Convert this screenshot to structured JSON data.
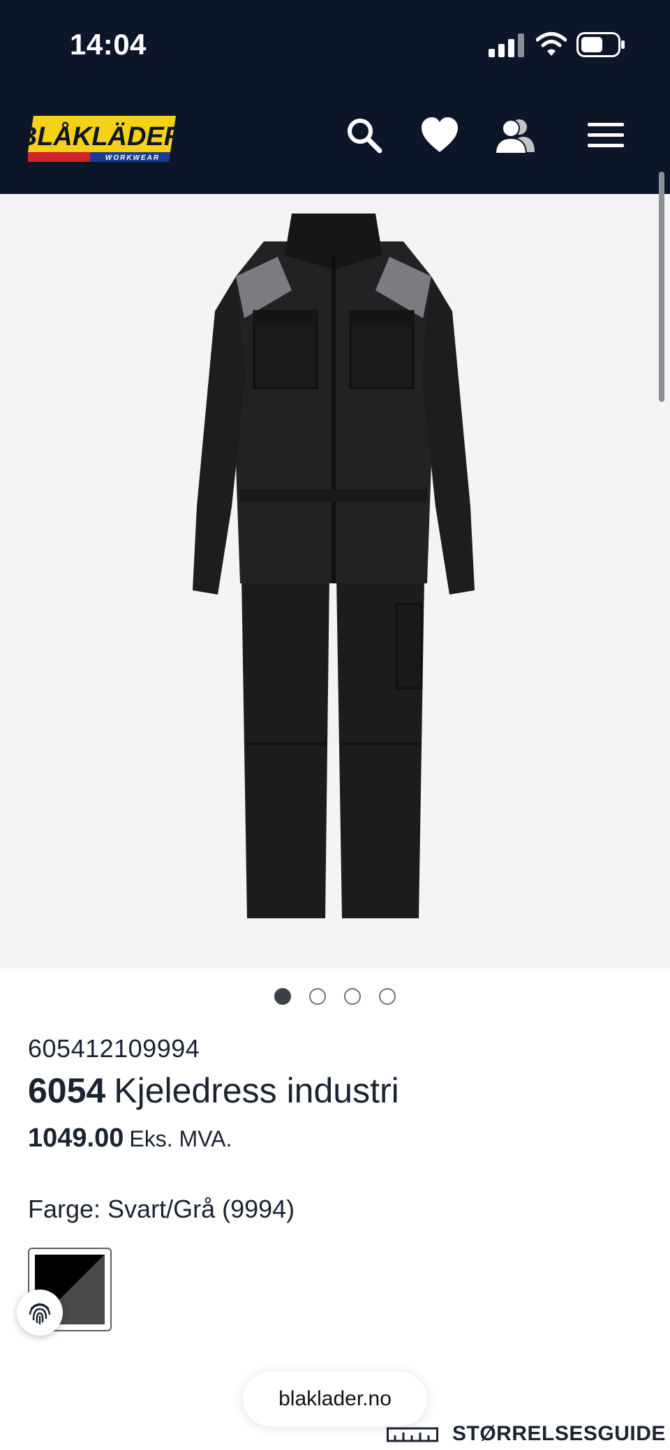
{
  "status_bar": {
    "time": "14:04"
  },
  "header": {
    "brand": "BLÅKLÄDER",
    "brand_sub": "WORKWEAR",
    "icons": [
      "search-icon",
      "heart-icon",
      "user-icon",
      "menu-icon"
    ]
  },
  "gallery": {
    "image_count": 4,
    "active_index": 0
  },
  "product": {
    "sku": "605412109994",
    "model_number": "6054",
    "name": "Kjeledress industri",
    "price": "1049.00",
    "price_note": "Eks. MVA.",
    "color_label": "Farge: Svart/Grå (9994)"
  },
  "browser": {
    "url": "blaklader.no"
  },
  "size_guide": {
    "label": "STØRRELSESGUIDE"
  },
  "colors": {
    "header_bg": "#0d1628",
    "logo_yellow": "#f7d117",
    "logo_red": "#d2232a",
    "logo_blue": "#1b3d8f",
    "text": "#1b2230"
  }
}
